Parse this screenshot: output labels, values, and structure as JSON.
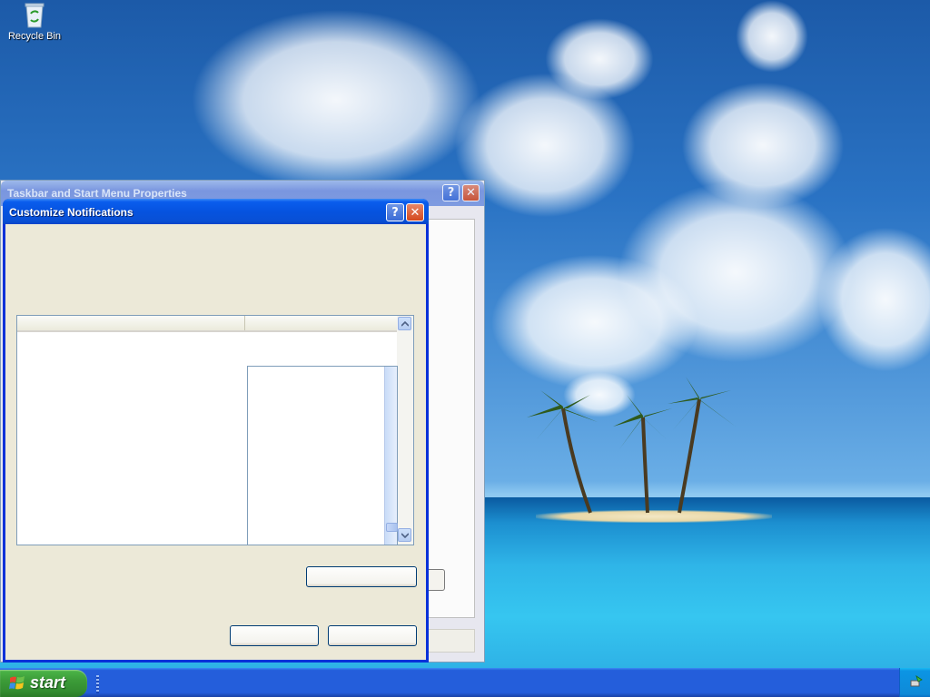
{
  "desktop": {
    "icons": [
      {
        "label": "Recycle Bin",
        "icon": "recycle-bin-icon"
      }
    ]
  },
  "back_window": {
    "title": "Taskbar and Start Menu Properties",
    "help_glyph": "?",
    "close_glyph": "✕"
  },
  "dialog": {
    "title": "Customize Notifications",
    "help_glyph": "?",
    "close_glyph": "✕",
    "list": {
      "columns": [
        "",
        ""
      ],
      "rows": []
    },
    "buttons": {
      "restore_defaults": "",
      "ok": "",
      "cancel": ""
    }
  },
  "taskbar": {
    "start_label": "start",
    "tray_icons": [
      "safely-remove-hardware-icon"
    ]
  },
  "colors": {
    "title_active": "#0a5ded",
    "title_inactive": "#7e9be0",
    "dialog_face": "#ece9d8",
    "taskbar": "#245edb",
    "start_green": "#3c9b38"
  }
}
